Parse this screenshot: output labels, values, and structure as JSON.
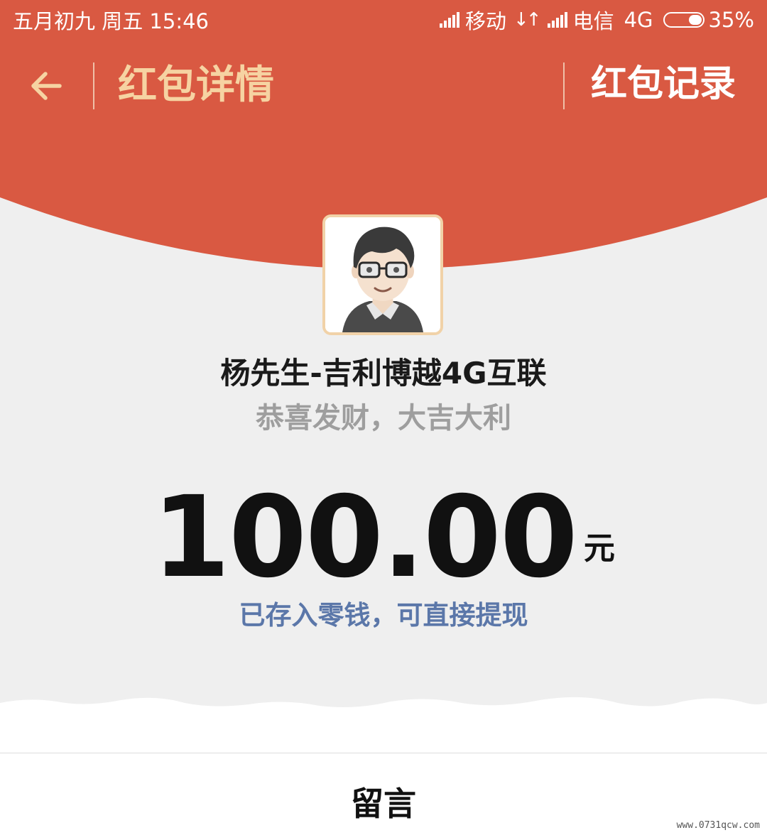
{
  "status_bar": {
    "datetime": "五月初九 周五 15:46",
    "carrier_1": "移动",
    "carrier_2": "电信",
    "network": "4G",
    "battery_percent": "35%",
    "battery_level": 0.35
  },
  "nav": {
    "back_icon": "back-arrow-icon",
    "title": "红包详情",
    "record_label": "红包记录"
  },
  "sender": {
    "name": "杨先生-吉利博越4G互联",
    "greeting": "恭喜发财，大吉大利"
  },
  "amount": {
    "value": "100.00",
    "unit": "元",
    "note": "已存入零钱，可直接提现"
  },
  "bottom": {
    "message_label": "留言"
  },
  "watermark": "www.0731qcw.com",
  "colors": {
    "header_red": "#d95942",
    "title_gold": "#f6d3a2",
    "link_blue": "#5b77a9",
    "background": "#efefef"
  }
}
